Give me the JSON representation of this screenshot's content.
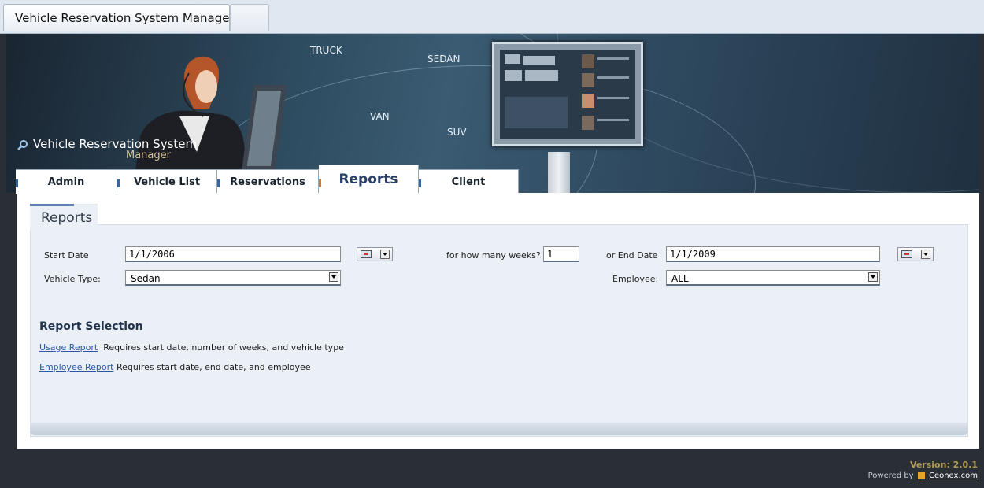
{
  "browser": {
    "tab_title": "Vehicle Reservation System Manager"
  },
  "banner": {
    "title": "Vehicle Reservation System",
    "subtitle": "Manager",
    "vehicle_labels": [
      "TRUCK",
      "SEDAN",
      "VAN",
      "SUV"
    ]
  },
  "nav": {
    "tabs": [
      {
        "label": "Admin"
      },
      {
        "label": "Vehicle List"
      },
      {
        "label": "Reservations"
      },
      {
        "label": "Reports"
      },
      {
        "label": "Client"
      }
    ],
    "active": "Reports"
  },
  "section": {
    "title": "Reports"
  },
  "form": {
    "start_date_label": "Start Date",
    "start_date_value": "1/1/2006",
    "weeks_label": "for how many weeks?",
    "weeks_value": "1",
    "end_date_label": "or End Date",
    "end_date_value": "1/1/2009",
    "vehicle_type_label": "Vehicle Type:",
    "vehicle_type_value": "Sedan",
    "employee_label": "Employee:",
    "employee_value": "ALL"
  },
  "reports": {
    "heading": "Report Selection",
    "items": [
      {
        "link": "Usage Report",
        "description": "Requires start date, number of weeks, and vehicle type"
      },
      {
        "link": "Employee Report",
        "description": "Requires start date, end date, and employee"
      }
    ]
  },
  "footer": {
    "version": "Version: 2.0.1",
    "powered_by": "Powered by",
    "company": "Ceonex.com"
  },
  "colors": {
    "accent": "#3466a8",
    "active_tab_mark": "#d07a2c",
    "link": "#2d56a7",
    "version": "#b29b55"
  }
}
